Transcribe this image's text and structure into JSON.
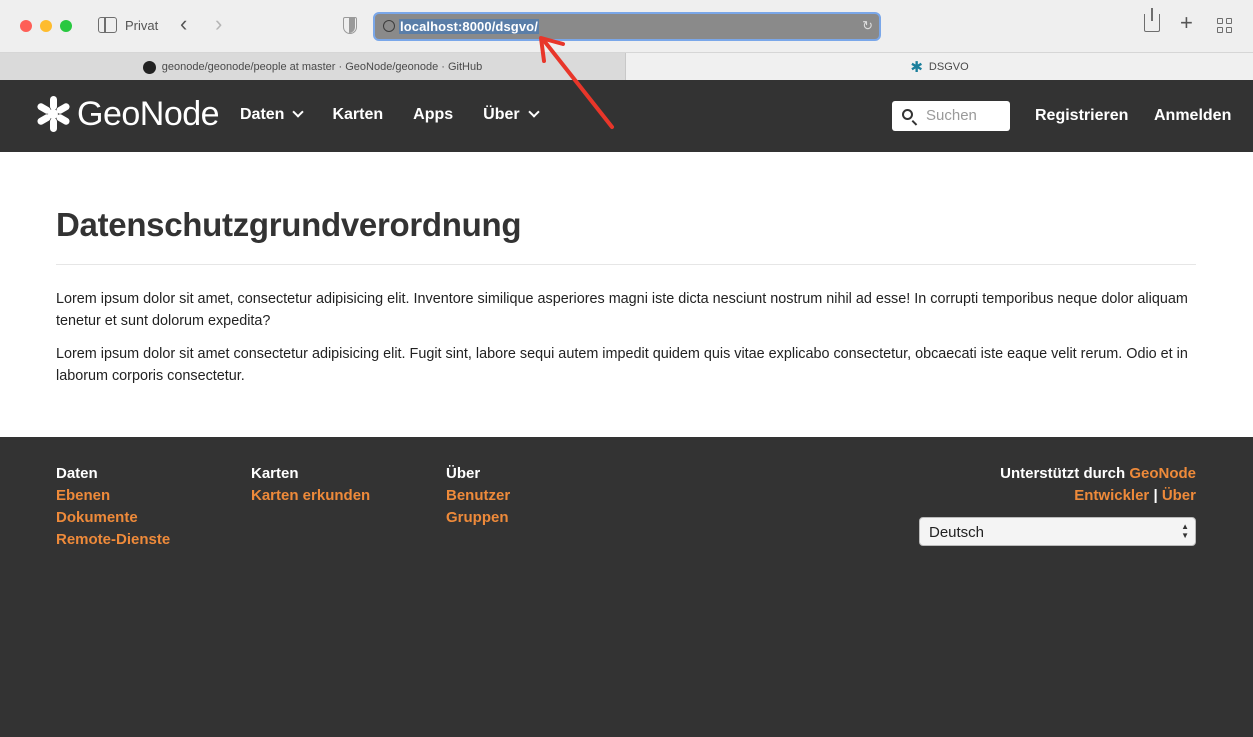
{
  "browser": {
    "private_label": "Privat",
    "url": "localhost:8000/dsgvo/",
    "tabs": [
      {
        "label": "geonode/geonode/people at master · GeoNode/geonode · GitHub",
        "icon": "github-icon"
      },
      {
        "label": "DSGVO",
        "icon": "geonode-favicon-icon"
      }
    ]
  },
  "site": {
    "logo_text": "GeoNode",
    "nav": {
      "daten": "Daten",
      "karten": "Karten",
      "apps": "Apps",
      "ueber": "Über"
    },
    "search_placeholder": "Suchen",
    "register": "Registrieren",
    "login": "Anmelden"
  },
  "page": {
    "title": "Datenschutzgrundverordnung",
    "paragraphs": [
      "Lorem ipsum dolor sit amet, consectetur adipisicing elit. Inventore similique asperiores magni iste dicta nesciunt nostrum nihil ad esse! In corrupti temporibus neque dolor aliquam tenetur et sunt dolorum expedita?",
      "Lorem ipsum dolor sit amet consectetur adipisicing elit. Fugit sint, labore sequi autem impedit quidem quis vitae explicabo consectetur, obcaecati iste eaque velit rerum. Odio et in laborum corporis consectetur."
    ]
  },
  "footer": {
    "col1": {
      "heading": "Daten",
      "links": [
        "Ebenen",
        "Dokumente",
        "Remote-Dienste"
      ]
    },
    "col2": {
      "heading": "Karten",
      "links": [
        "Karten erkunden"
      ]
    },
    "col3": {
      "heading": "Über",
      "links": [
        "Benutzer",
        "Gruppen"
      ]
    },
    "powered_by": "Unterstützt durch",
    "powered_link": "GeoNode",
    "dev_link": "Entwickler",
    "separator": "|",
    "about_link": "Über",
    "language": "Deutsch"
  },
  "colors": {
    "header_bg": "#333333",
    "accent": "#ee8a3a",
    "annotation_arrow": "#e8362a"
  }
}
